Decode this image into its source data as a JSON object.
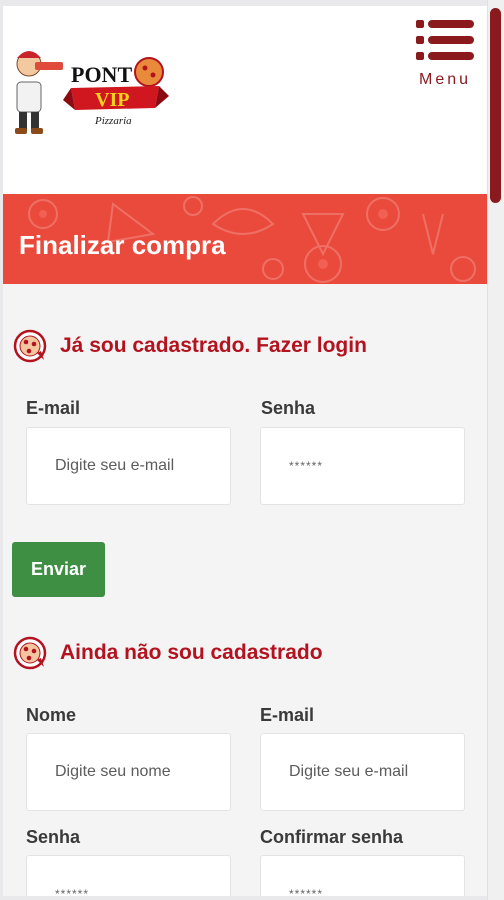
{
  "header": {
    "logo": {
      "brand_word_1": "PONT",
      "brand_word_2": "VIP",
      "brand_sub": "Pizzaria"
    },
    "menu_label": "Menu"
  },
  "banner": {
    "title": "Finalizar compra"
  },
  "login_section": {
    "title": "Já sou cadastrado. Fazer login",
    "email_label": "E-mail",
    "email_placeholder": "Digite seu e-mail",
    "password_label": "Senha",
    "password_placeholder": "******",
    "submit_label": "Enviar"
  },
  "register_section": {
    "title": "Ainda não sou cadastrado",
    "name_label": "Nome",
    "name_placeholder": "Digite seu nome",
    "email_label": "E-mail",
    "email_placeholder": "Digite seu e-mail",
    "password_label": "Senha",
    "password_placeholder": "******",
    "confirm_label": "Confirmar senha",
    "confirm_placeholder": "******"
  },
  "colors": {
    "brand_dark_red": "#8a1a1d",
    "banner_red": "#ea4a3c",
    "section_title_red": "#b3121f",
    "button_green": "#3e8e44"
  }
}
